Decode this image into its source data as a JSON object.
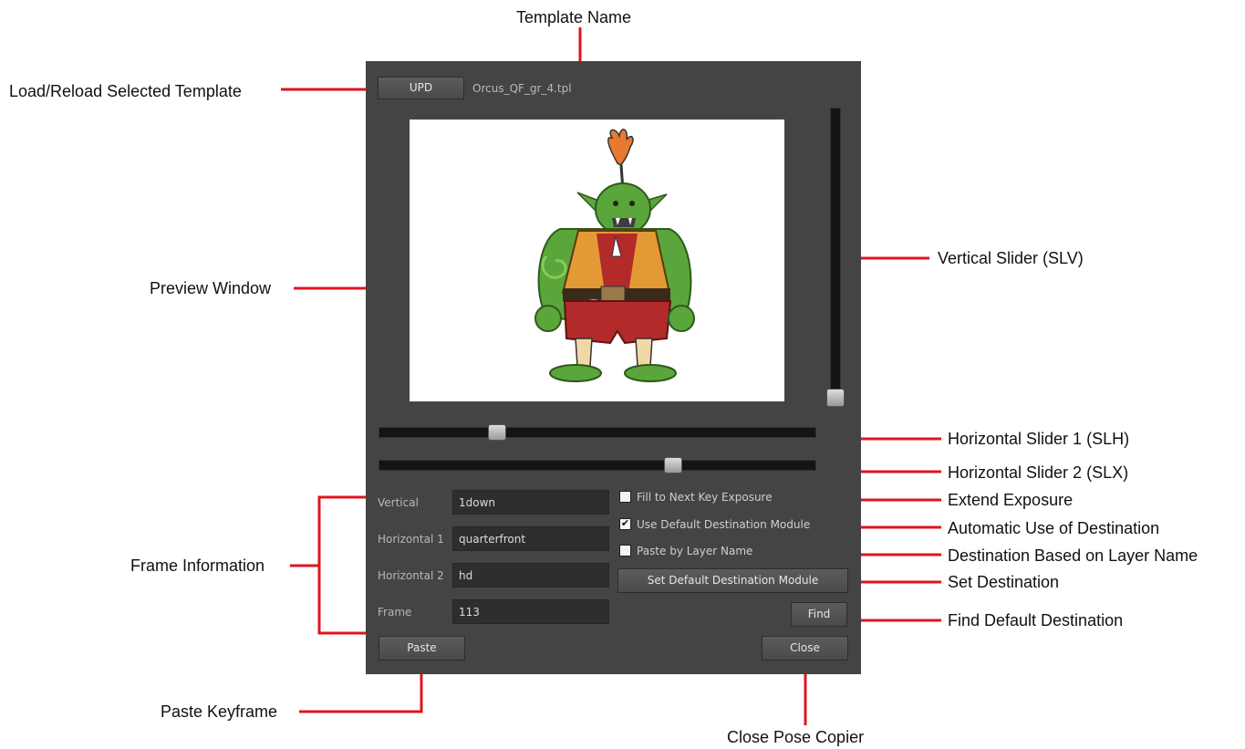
{
  "annotations": {
    "template_name": "Template Name",
    "load_reload": "Load/Reload Selected Template",
    "preview_window": "Preview Window",
    "vertical_slider": "Vertical Slider (SLV)",
    "horizontal_slider_1": "Horizontal Slider 1 (SLH)",
    "horizontal_slider_2": "Horizontal Slider 2 (SLX)",
    "extend_exposure": "Extend Exposure",
    "automatic_destination": "Automatic Use of Destination",
    "destination_layer_name": "Destination Based on Layer Name",
    "set_destination": "Set Destination",
    "find_default_destination": "Find Default Destination",
    "frame_information": "Frame Information",
    "paste_keyframe": "Paste Keyframe",
    "close_pose_copier": "Close Pose Copier"
  },
  "panel": {
    "upd_label": "UPD",
    "template_file": "Orcus_QF_gr_4.tpl",
    "sliders": {
      "vertical_level": 0.0,
      "horizontal1_level": 0.26,
      "horizontal2_level": 0.68
    },
    "fields": [
      {
        "label": "Vertical",
        "value": "1down"
      },
      {
        "label": "Horizontal 1",
        "value": "quarterfront"
      },
      {
        "label": "Horizontal 2",
        "value": "hd"
      },
      {
        "label": "Frame",
        "value": "113"
      }
    ],
    "options": {
      "fill_next_key": {
        "label": "Fill to Next Key Exposure",
        "checked": false
      },
      "use_default_dest": {
        "label": "Use Default Destination Module",
        "checked": true
      },
      "paste_by_layer": {
        "label": "Paste by Layer Name",
        "checked": false
      }
    },
    "set_default_dest_label": "Set Default Destination Module",
    "find_label": "Find",
    "paste_label": "Paste",
    "close_label": "Close"
  },
  "colors": {
    "panel_bg": "#444444",
    "callout_line": "#e0141e",
    "character_skin": "#5aa63a",
    "vest": "#e39a35",
    "shorts": "#b22a2a"
  }
}
